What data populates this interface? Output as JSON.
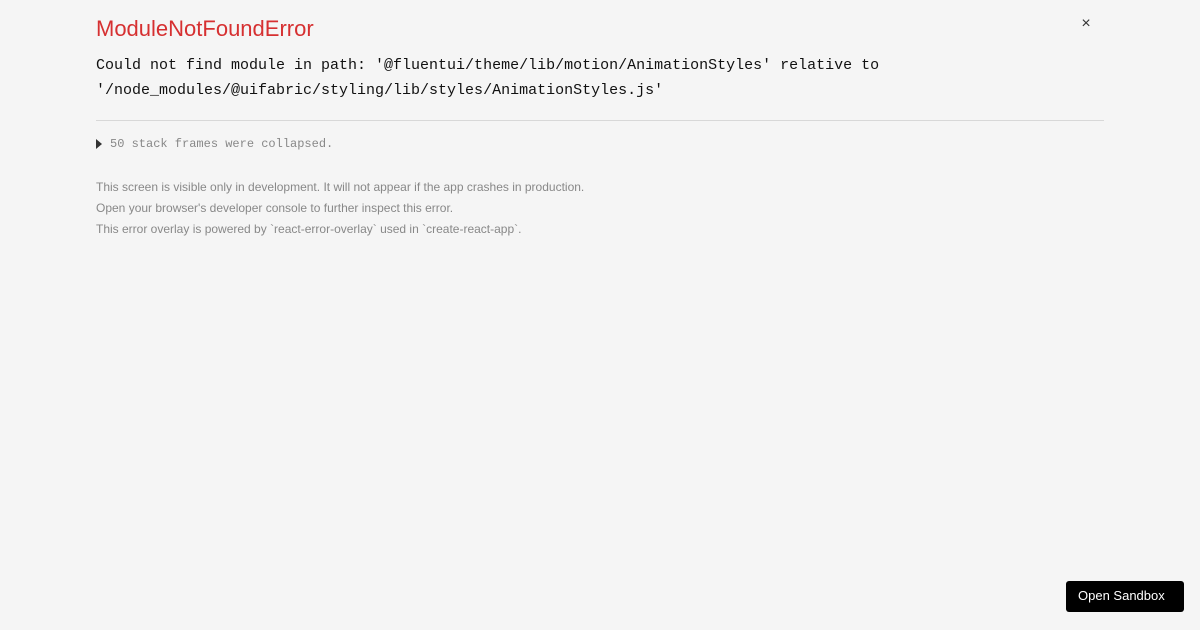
{
  "error": {
    "title": "ModuleNotFoundError",
    "message": "Could not find module in path: '@fluentui/theme/lib/motion/AnimationStyles' relative to '/node_modules/@uifabric/styling/lib/styles/AnimationStyles.js'"
  },
  "stack": {
    "collapsed_text": "50 stack frames were collapsed."
  },
  "footer": {
    "line1": "This screen is visible only in development. It will not appear if the app crashes in production.",
    "line2": "Open your browser's developer console to further inspect this error.",
    "line3": "This error overlay is powered by `react-error-overlay` used in `create-react-app`."
  },
  "buttons": {
    "close": "×",
    "open_sandbox": "Open Sandbox"
  }
}
